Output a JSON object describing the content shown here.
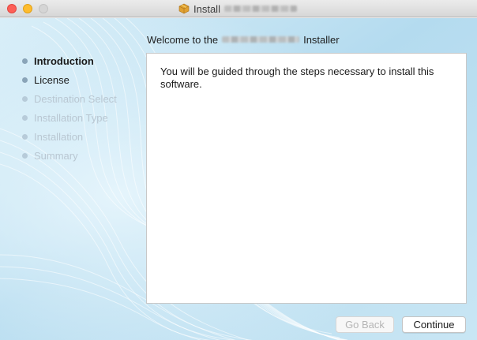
{
  "window": {
    "title_prefix": "Install",
    "product_name_redacted": true
  },
  "header": {
    "welcome_prefix": "Welcome to the",
    "welcome_suffix": "Installer"
  },
  "steps": [
    {
      "label": "Introduction",
      "state": "current"
    },
    {
      "label": "License",
      "state": "done"
    },
    {
      "label": "Destination Select",
      "state": "pending"
    },
    {
      "label": "Installation Type",
      "state": "pending"
    },
    {
      "label": "Installation",
      "state": "pending"
    },
    {
      "label": "Summary",
      "state": "pending"
    }
  ],
  "content": {
    "text": "You will be guided through the steps necessary to install this software."
  },
  "buttons": {
    "back_label": "Go Back",
    "continue_label": "Continue"
  },
  "colors": {
    "sidebar_blue": "#b9dcef",
    "close": "#fd5f57",
    "minimize": "#febc2e",
    "zoom_disabled": "#d5d5d5"
  }
}
